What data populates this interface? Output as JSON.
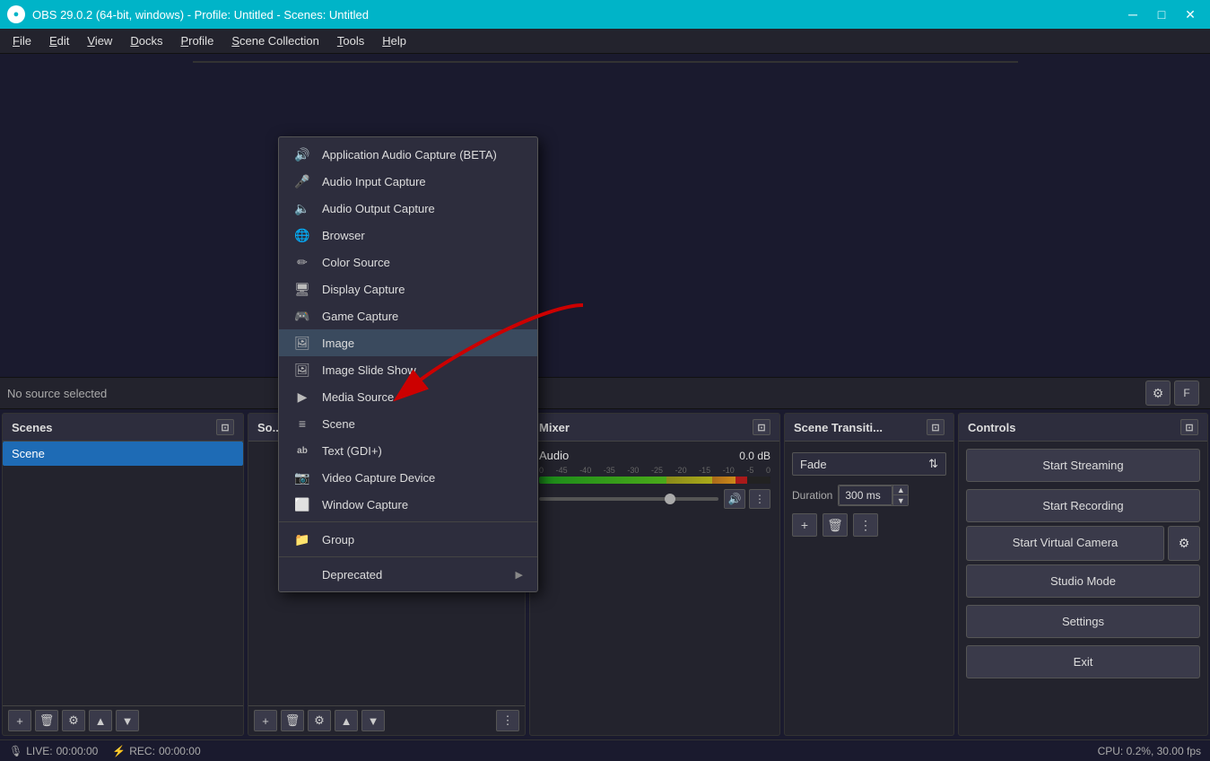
{
  "titlebar": {
    "title": "OBS 29.0.2 (64-bit, windows) - Profile: Untitled - Scenes: Untitled",
    "icon": "OBS",
    "minimize": "─",
    "maximize": "□",
    "close": "✕"
  },
  "menubar": {
    "items": [
      {
        "label": "File",
        "underline": "F"
      },
      {
        "label": "Edit",
        "underline": "E"
      },
      {
        "label": "View",
        "underline": "V"
      },
      {
        "label": "Docks",
        "underline": "D"
      },
      {
        "label": "Profile",
        "underline": "P"
      },
      {
        "label": "Scene Collection",
        "underline": "S"
      },
      {
        "label": "Tools",
        "underline": "T"
      },
      {
        "label": "Help",
        "underline": "H"
      }
    ]
  },
  "status_area": {
    "no_source": "No source selected"
  },
  "scenes_panel": {
    "title": "Scenes",
    "items": [
      {
        "label": "Scene",
        "selected": true
      }
    ]
  },
  "sources_panel": {
    "title": "So..."
  },
  "context_menu": {
    "items": [
      {
        "label": "Application Audio Capture (BETA)",
        "icon": "🔊"
      },
      {
        "label": "Audio Input Capture",
        "icon": "🎤"
      },
      {
        "label": "Audio Output Capture",
        "icon": "🔈"
      },
      {
        "label": "Browser",
        "icon": "🌐"
      },
      {
        "label": "Color Source",
        "icon": "✏️"
      },
      {
        "label": "Display Capture",
        "icon": "🖥"
      },
      {
        "label": "Game Capture",
        "icon": "🎮"
      },
      {
        "label": "Image",
        "icon": "🖼"
      },
      {
        "label": "Image Slide Show",
        "icon": "🖼"
      },
      {
        "label": "Media Source",
        "icon": "▶"
      },
      {
        "label": "Scene",
        "icon": "≡"
      },
      {
        "label": "Text (GDI+)",
        "icon": "ab"
      },
      {
        "label": "Video Capture Device",
        "icon": "📷"
      },
      {
        "label": "Window Capture",
        "icon": "⬜"
      },
      {
        "separator": true
      },
      {
        "label": "Group",
        "icon": "📁"
      },
      {
        "separator": true
      },
      {
        "label": "Deprecated",
        "icon": "",
        "arrow": true
      }
    ]
  },
  "mixer_panel": {
    "title": "Mixer",
    "audio_label": "Audio",
    "db_value": "0.0 dB",
    "meter_labels": "0  -45  -40  -35  -30  -25  -20  -15  -10  -5  0"
  },
  "transition_panel": {
    "title": "Scene Transiti...",
    "fade_label": "Fade",
    "duration_label": "Duration",
    "duration_value": "300 ms"
  },
  "controls_panel": {
    "title": "Controls",
    "start_streaming": "Start Streaming",
    "start_recording": "Start Recording",
    "start_virtual_camera": "Start Virtual Camera",
    "studio_mode": "Studio Mode",
    "settings": "Settings",
    "exit": "Exit"
  },
  "statusbar": {
    "live_icon": "🎙",
    "live_label": "LIVE:",
    "live_time": "00:00:00",
    "rec_icon": "⚡",
    "rec_label": "REC:",
    "rec_time": "00:00:00",
    "cpu": "CPU: 0.2%, 30.00 fps"
  }
}
